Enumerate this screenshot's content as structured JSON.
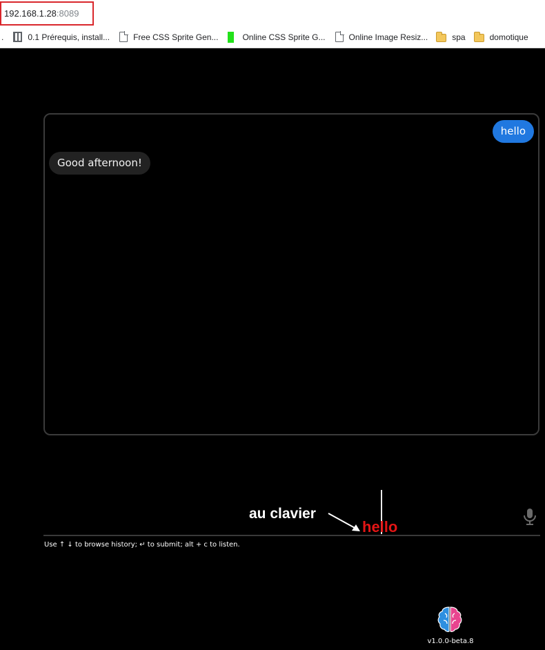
{
  "browser": {
    "url_host": "192.168.1.28",
    "url_port": ":8089",
    "bookmarks": [
      {
        "label": "0.1 Prérequis, install...",
        "icon": "document-icon"
      },
      {
        "label": "Free CSS Sprite Gen...",
        "icon": "page-icon"
      },
      {
        "label": "Online CSS Sprite G...",
        "icon": "green-bar-icon"
      },
      {
        "label": "Online Image Resiz...",
        "icon": "page-icon"
      },
      {
        "label": "spa",
        "icon": "folder-icon"
      },
      {
        "label": "domotique",
        "icon": "folder-icon"
      }
    ]
  },
  "chat": {
    "messages": [
      {
        "role": "user",
        "text": "hello"
      },
      {
        "role": "assistant",
        "text": "Good afternoon!"
      }
    ]
  },
  "input": {
    "value": "hello",
    "mic_icon": "microphone-icon",
    "hint": "Use ↑ ↓ to browse history; ↵ to submit; alt + c to listen."
  },
  "annotation": {
    "text": "au clavier"
  },
  "footer": {
    "version": "v1.0.0-beta.8",
    "logo_icon": "brain-icon",
    "logo_colors": {
      "left": "#2e8fe0",
      "right": "#e8458f"
    }
  },
  "colors": {
    "user_bubble": "#2078e0",
    "assistant_bubble": "#222222",
    "typed_text": "#e41515",
    "url_highlight": "#d9262b"
  }
}
